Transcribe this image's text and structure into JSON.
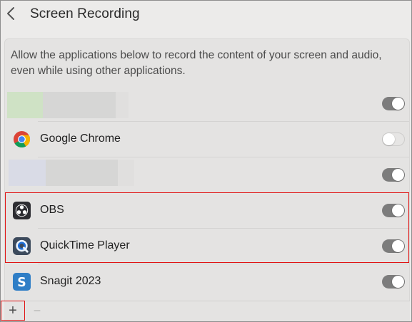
{
  "header": {
    "title": "Screen Recording",
    "back_icon": "chevron-left-icon"
  },
  "description": "Allow the applications below to record the content of your screen and audio, even while using other applications.",
  "apps": [
    {
      "name": "",
      "redacted": true,
      "enabled": true
    },
    {
      "name": "Google Chrome",
      "icon": "chrome-icon",
      "enabled": false
    },
    {
      "name": "",
      "redacted": true,
      "enabled": true
    },
    {
      "name": "OBS",
      "icon": "obs-icon",
      "enabled": true
    },
    {
      "name": "QuickTime Player",
      "icon": "quicktime-icon",
      "enabled": true
    },
    {
      "name": "Snagit 2023",
      "icon": "snagit-icon",
      "enabled": true
    }
  ],
  "footer": {
    "add_label": "+",
    "remove_label": "−"
  },
  "colors": {
    "highlight": "#e01414",
    "toggle_on": "#7c7c7c"
  }
}
